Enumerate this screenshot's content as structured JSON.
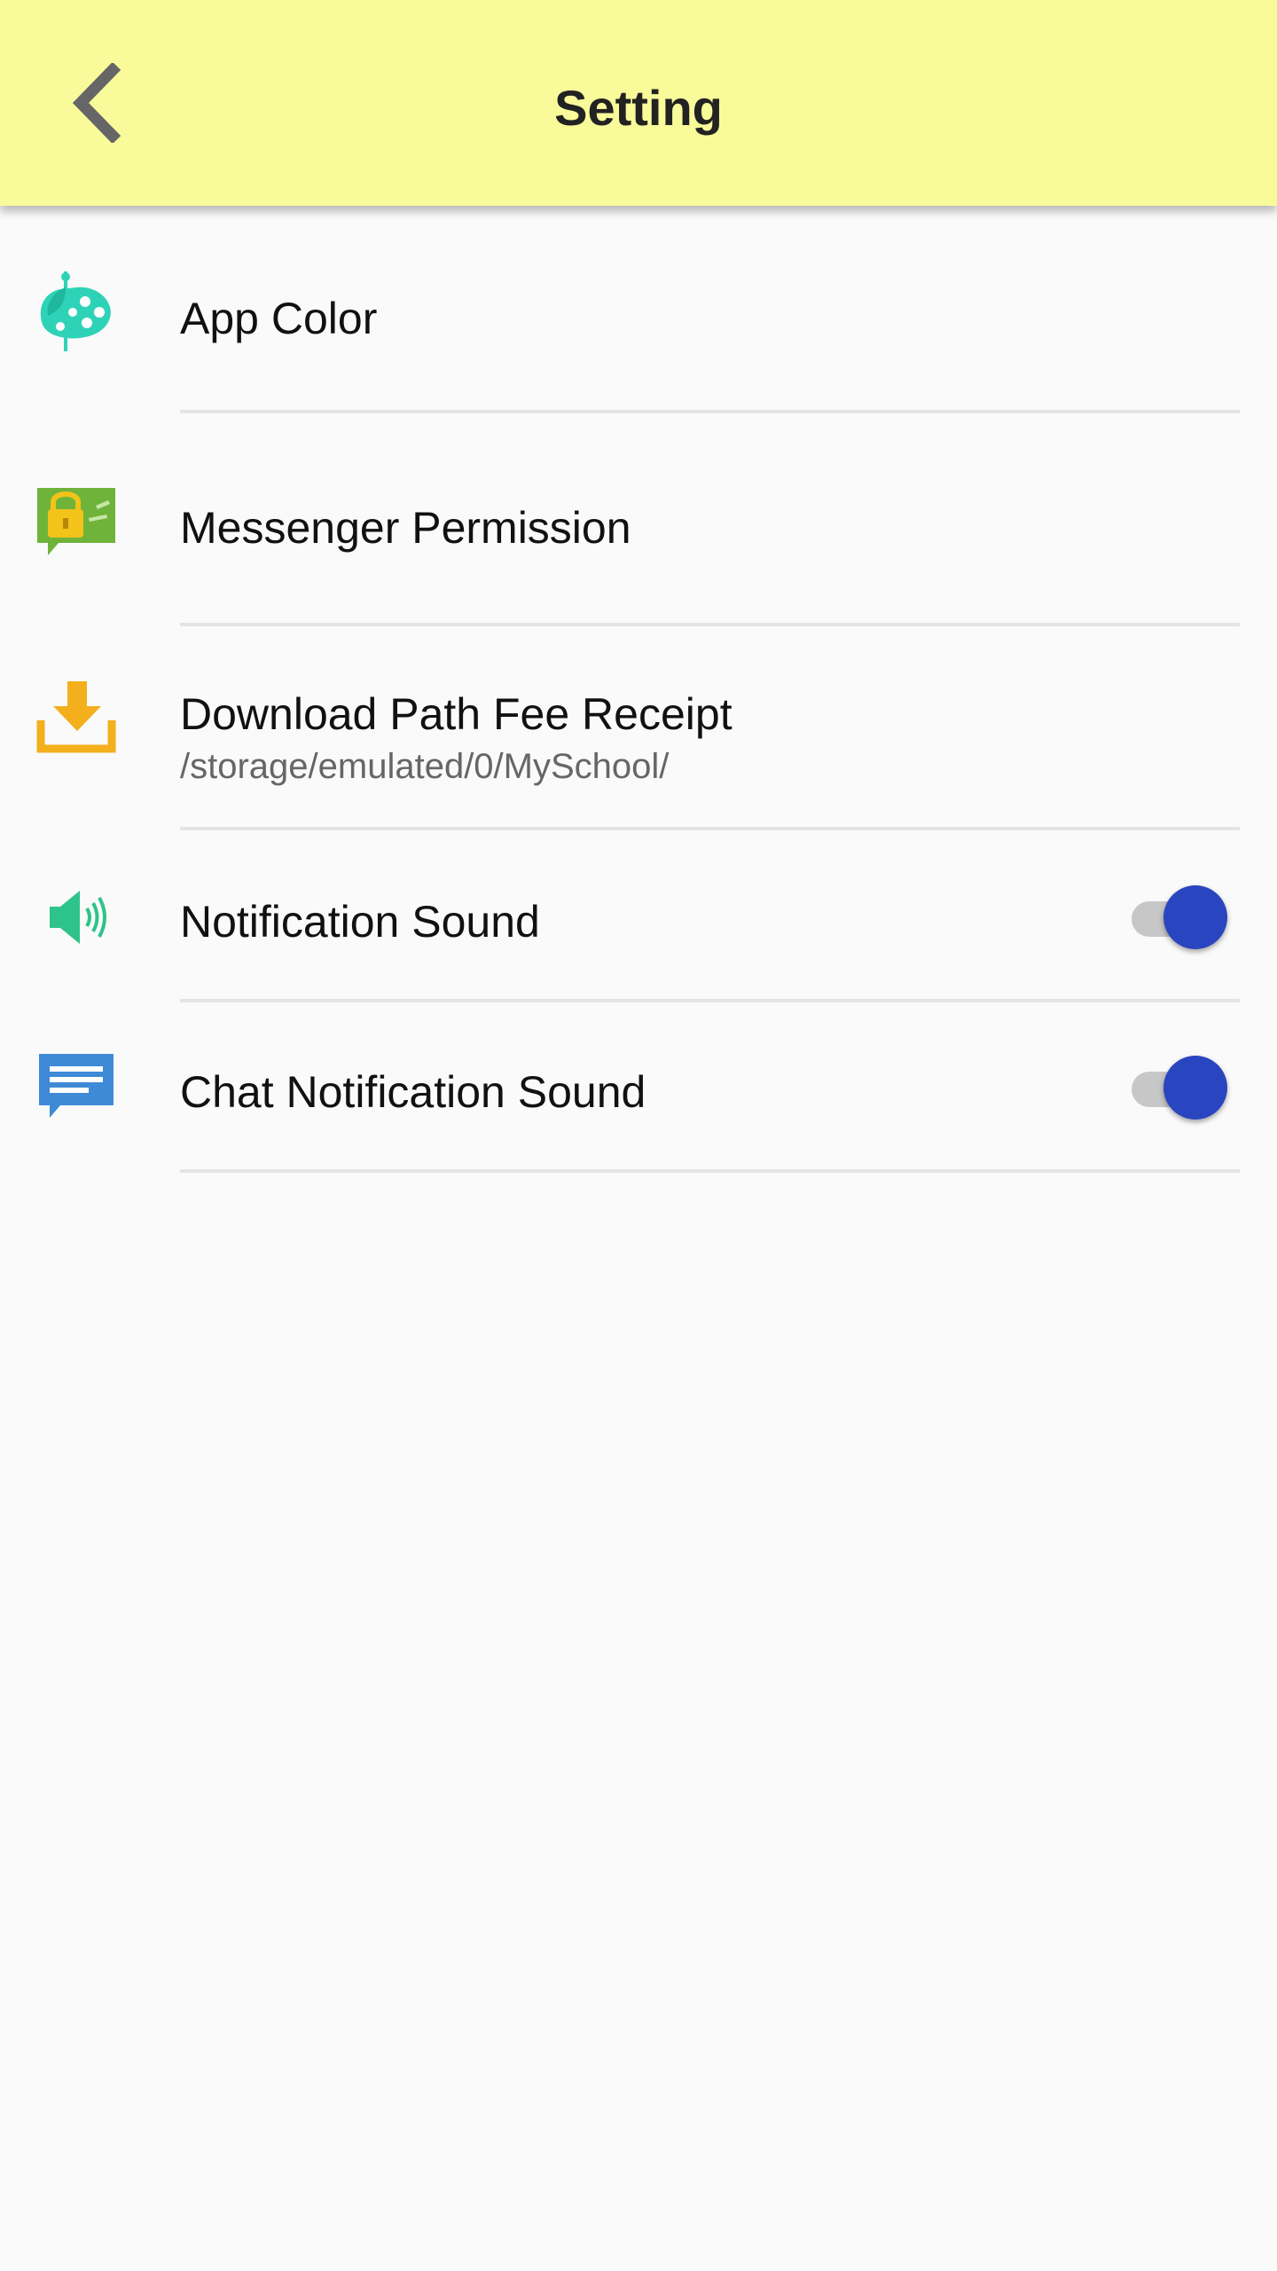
{
  "header": {
    "title": "Setting",
    "back_icon": "chevron-left-icon",
    "background_color": "#f9fb9a"
  },
  "settings": [
    {
      "icon": "palette-icon",
      "label": "App Color"
    },
    {
      "icon": "lock-message-icon",
      "label": "Messenger Permission"
    },
    {
      "icon": "download-icon",
      "label": "Download Path Fee Receipt",
      "sublabel": "/storage/emulated/0/MySchool/"
    },
    {
      "icon": "speaker-icon",
      "label": "Notification Sound",
      "toggle": true
    },
    {
      "icon": "chat-icon",
      "label": "Chat Notification Sound",
      "toggle": true
    }
  ],
  "colors": {
    "toggle_on": "#2a45c0",
    "palette_icon": "#2ed3b7",
    "lock_message_icon": "#6fb33a",
    "download_icon": "#f3b01c",
    "speaker_icon": "#2ec38a",
    "chat_icon": "#3f8ad6"
  }
}
